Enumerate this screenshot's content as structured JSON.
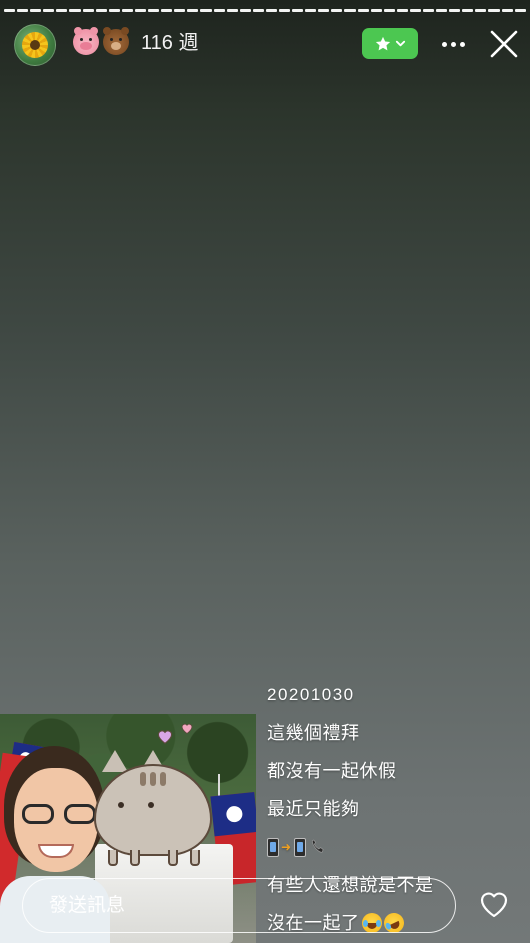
{
  "header": {
    "progress": {
      "segments": 40,
      "completed": 40
    },
    "avatar_icon": "sunflower-icon",
    "emoji_icons": [
      "pig-face-icon",
      "bear-face-icon"
    ],
    "weeks_label": "116 週",
    "favorite_button_color": "#4cc751"
  },
  "caption": {
    "date": "20201030",
    "lines": [
      "這幾個禮拜",
      "都沒有一起休假",
      "最近只能夠",
      "有些人還想說是不是",
      "沒在一起了"
    ],
    "icons_line": [
      "mobile-phone-icon",
      "arrow-right-icon",
      "mobile-phone-icon",
      "telephone-handset-icon"
    ],
    "trailing_emoji": [
      "laughing-face-icon",
      "rolling-laughing-face-icon"
    ]
  },
  "message": {
    "placeholder": "發送訊息"
  },
  "photo": {
    "description_icons": [
      "flag-icon",
      "pusheen-cat-sticker",
      "heart-icon"
    ]
  },
  "colors": {
    "accent": "#4cc751",
    "background_top": "#1e241e",
    "background_bottom": "#737878"
  }
}
